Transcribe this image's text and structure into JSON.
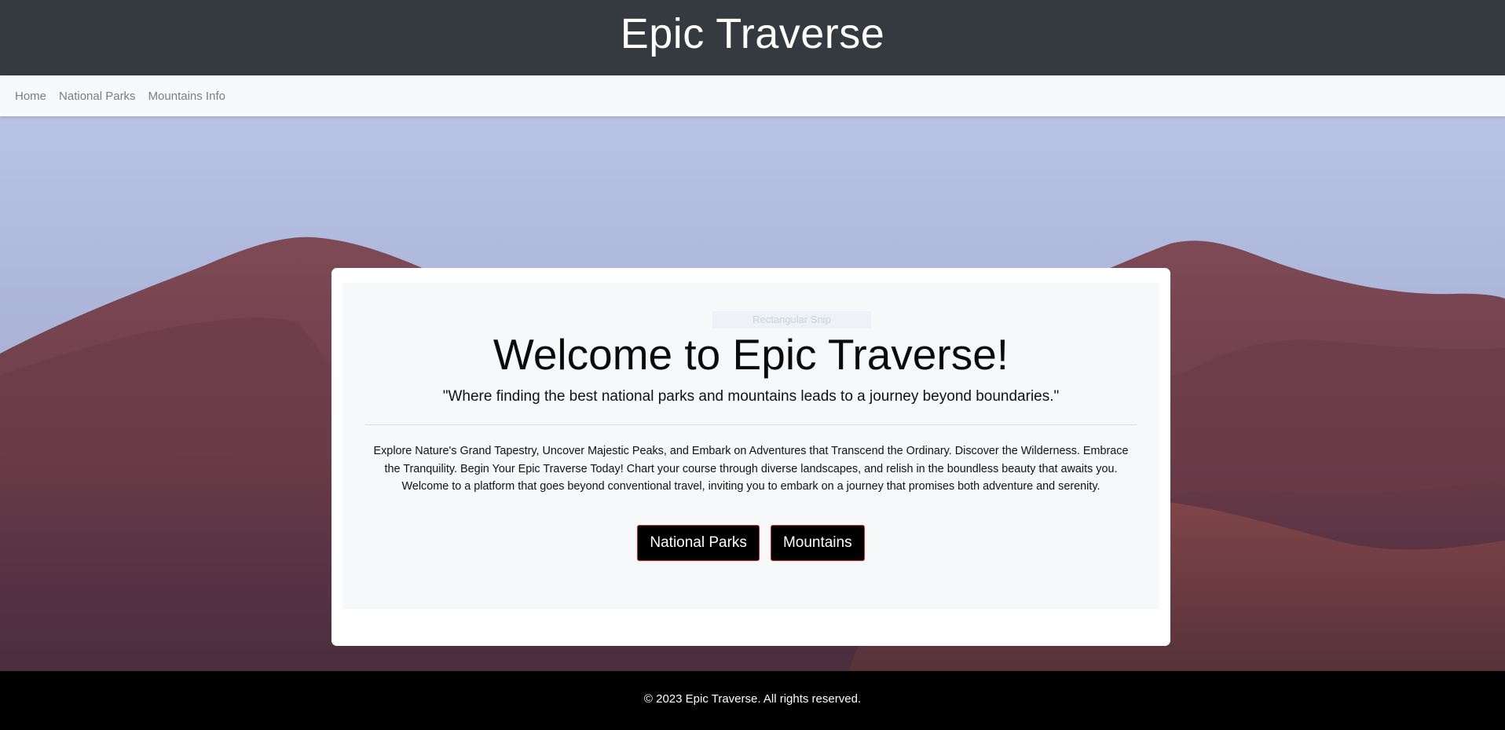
{
  "header": {
    "title": "Epic Traverse"
  },
  "nav": {
    "items": [
      {
        "label": "Home"
      },
      {
        "label": "National Parks"
      },
      {
        "label": "Mountains Info"
      }
    ]
  },
  "hero": {
    "snip_label": "Rectangular Snip",
    "heading": "Welcome to Epic Traverse!",
    "tagline": "\"Where finding the best national parks and mountains leads to a journey beyond boundaries.\"",
    "description": "Explore Nature's Grand Tapestry, Uncover Majestic Peaks, and Embark on Adventures that Transcend the Ordinary. Discover the Wilderness. Embrace the Tranquility. Begin Your Epic Traverse Today! Chart your course through diverse landscapes, and relish in the boundless beauty that awaits you. Welcome to a platform that goes beyond conventional travel, inviting you to embark on a journey that promises both adventure and serenity.",
    "buttons": {
      "national_parks": "National Parks",
      "mountains": "Mountains"
    }
  },
  "footer": {
    "text": "© 2023 Epic Traverse. All rights reserved."
  },
  "colors": {
    "header_bg": "#343a40",
    "nav_bg": "#f8f9fa",
    "button_bg": "#000000",
    "button_border": "#d02a2a",
    "footer_bg": "#000000"
  }
}
